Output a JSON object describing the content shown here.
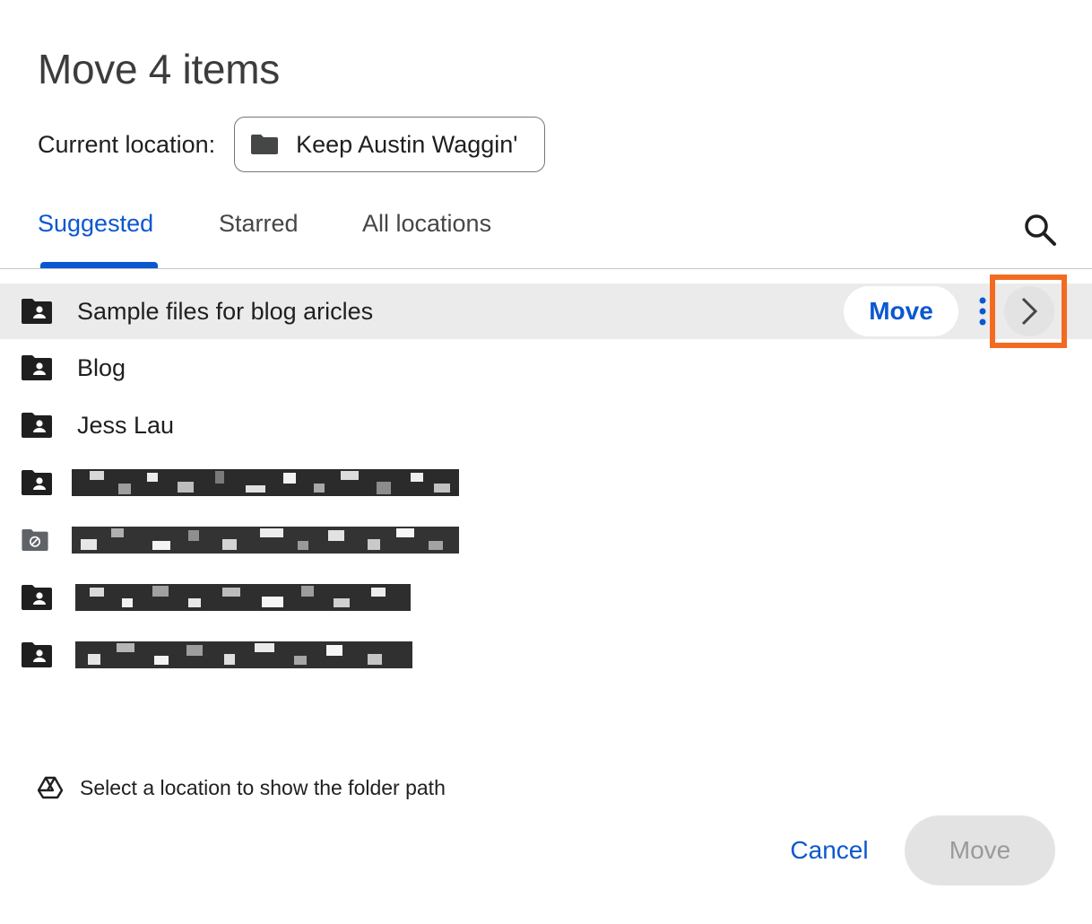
{
  "dialog": {
    "title": "Move 4 items",
    "current_location_label": "Current location:",
    "current_location_value": "Keep Austin Waggin'"
  },
  "tabs": [
    {
      "label": "Suggested",
      "active": true
    },
    {
      "label": "Starred",
      "active": false
    },
    {
      "label": "All locations",
      "active": false
    }
  ],
  "list": {
    "items": [
      {
        "name": "Sample files for blog aricles",
        "icon": "shared-folder-icon",
        "selected": true
      },
      {
        "name": "Blog",
        "icon": "shared-folder-icon",
        "selected": false
      },
      {
        "name": "Jess Lau",
        "icon": "shared-folder-icon",
        "selected": false
      },
      {
        "name": "",
        "icon": "shared-folder-icon",
        "redacted": true
      },
      {
        "name": "",
        "icon": "restricted-folder-icon",
        "redacted": true
      },
      {
        "name": "",
        "icon": "shared-folder-icon",
        "redacted": true
      },
      {
        "name": "",
        "icon": "shared-folder-icon",
        "redacted": true
      }
    ],
    "row_move_label": "Move"
  },
  "footer": {
    "info_text": "Select a location to show the folder path",
    "cancel_label": "Cancel",
    "move_label": "Move"
  },
  "colors": {
    "accent": "#0b57d0",
    "highlight": "#f26b21",
    "selected_row": "#ebebeb",
    "disabled_button": "#e3e3e3"
  }
}
